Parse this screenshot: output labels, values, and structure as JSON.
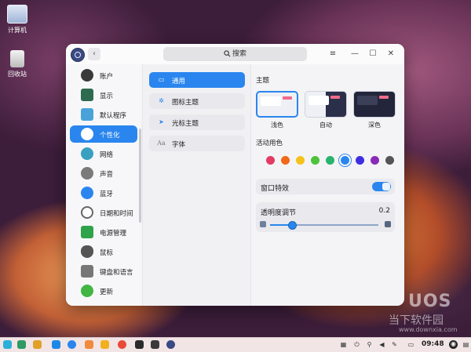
{
  "desktop": {
    "icons": [
      {
        "label": "计算机",
        "icon": "computer-icon"
      },
      {
        "label": "回收站",
        "icon": "trash-icon"
      }
    ]
  },
  "window": {
    "back_glyph": "‹",
    "search_label": "搜索",
    "controls": {
      "menu": "≡",
      "minimize": "—",
      "maximize": "☐",
      "close": "✕"
    }
  },
  "sidebar": {
    "items": [
      {
        "label": "账户",
        "icon": "account-icon",
        "color": "#3a3a3a"
      },
      {
        "label": "显示",
        "icon": "display-icon",
        "color": "#2d6a4f"
      },
      {
        "label": "默认程序",
        "icon": "default-apps-icon",
        "color": "#4aa3d8"
      },
      {
        "label": "个性化",
        "icon": "personalization-icon",
        "color": "#2f6fd6",
        "active": true
      },
      {
        "label": "网络",
        "icon": "network-icon",
        "color": "#3aa0c0"
      },
      {
        "label": "声音",
        "icon": "sound-icon",
        "color": "#7a7a7a"
      },
      {
        "label": "蓝牙",
        "icon": "bluetooth-icon",
        "color": "#2a86ee"
      },
      {
        "label": "日期和时间",
        "icon": "clock-icon",
        "color": "#666666"
      },
      {
        "label": "电源管理",
        "icon": "power-icon",
        "color": "#2fa34a"
      },
      {
        "label": "鼠标",
        "icon": "mouse-icon",
        "color": "#555555"
      },
      {
        "label": "键盘和语言",
        "icon": "keyboard-icon",
        "color": "#777777"
      },
      {
        "label": "更新",
        "icon": "update-icon",
        "color": "#41b642"
      }
    ]
  },
  "subnav": {
    "items": [
      {
        "label": "通用",
        "icon": "general-icon",
        "glyph": "▭",
        "active": true
      },
      {
        "label": "图标主题",
        "icon": "icon-theme-icon",
        "glyph": "✲"
      },
      {
        "label": "光标主题",
        "icon": "cursor-theme-icon",
        "glyph": "➤"
      },
      {
        "label": "字体",
        "icon": "font-icon",
        "glyph": "Aa"
      }
    ]
  },
  "content": {
    "theme_title": "主题",
    "themes": [
      {
        "label": "浅色",
        "selected": true
      },
      {
        "label": "自动",
        "selected": false
      },
      {
        "label": "深色",
        "selected": false
      }
    ],
    "accent_title": "活动用色",
    "accent_colors": [
      "#e23b64",
      "#f06a1a",
      "#f5c21a",
      "#4cc33a",
      "#2ab36e",
      "#2a86ee",
      "#3d2fe0",
      "#8a2bb8",
      "#555555"
    ],
    "accent_selected_index": 5,
    "window_effect_label": "窗口特效",
    "window_effect_on": true,
    "transparency_label": "透明度调节",
    "transparency_value": "0.2",
    "transparency_fraction": 0.2
  },
  "taskbar": {
    "apps": [
      "launcher-icon",
      "multitask-view-icon",
      "file-manager-icon",
      "app-store-icon",
      "browser-icon",
      "calendar-icon",
      "photos-icon",
      "music-icon",
      "video-icon",
      "terminal-icon",
      "settings-icon"
    ],
    "app_colors": [
      "#2cb0d8",
      "#2f9a62",
      "#e0a12a",
      "#1e88e5",
      "#2a86ee",
      "#f08a3c",
      "#f2b01e",
      "#e84a3a",
      "#2a2a2a",
      "#3a3a3a",
      "#3a4a82"
    ],
    "tray": [
      "network-tray-icon",
      "power-tray-icon",
      "usb-icon",
      "volume-icon",
      "pen-icon",
      "screen-icon",
      "keyboard-tray-icon"
    ],
    "clock": "09:48"
  },
  "watermark": {
    "brand": "UOS",
    "site": "当下软件园",
    "url": "www.downxia.com"
  }
}
